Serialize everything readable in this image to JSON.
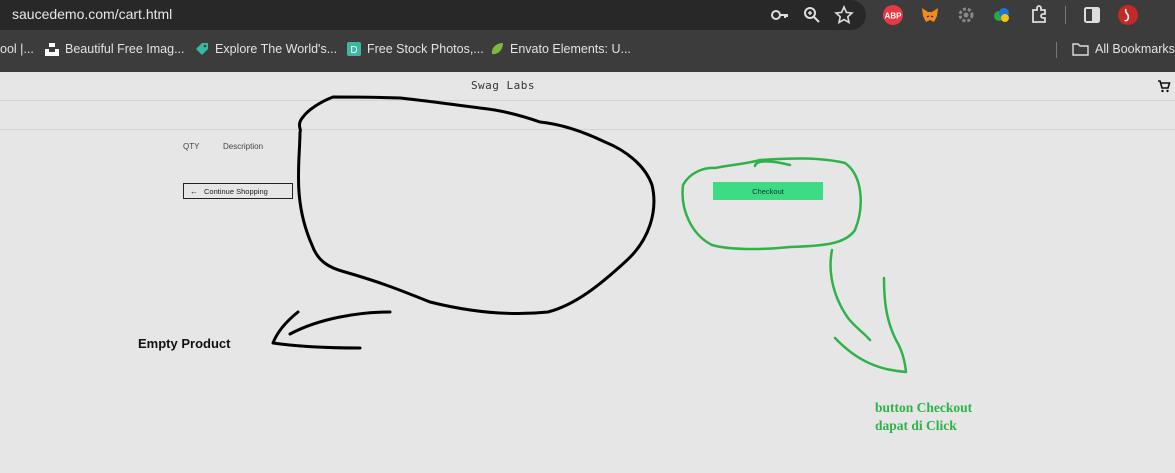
{
  "browser": {
    "url": "saucedemo.com/cart.html",
    "bookmarks": [
      {
        "label": "ool |..."
      },
      {
        "label": "Beautiful Free Imag..."
      },
      {
        "label": "Explore The World's..."
      },
      {
        "label": "Free Stock Photos,..."
      },
      {
        "label": "Envato Elements: U..."
      }
    ],
    "all_bookmarks_label": "All Bookmarks",
    "extensions": {
      "abp_label": "ABP"
    },
    "colors": {
      "chrome_bg": "#3c3c3c",
      "address_bg": "#282828"
    }
  },
  "header": {
    "logo": "Swag Labs"
  },
  "cart": {
    "qty_label": "QTY",
    "description_label": "Description",
    "continue_label": "Continue Shopping",
    "checkout_label": "Checkout"
  },
  "annotations": {
    "empty_product": "Empty Product",
    "checkout_note_line1": "button Checkout",
    "checkout_note_line2": "dapat di Click",
    "colors": {
      "black_marker": "#000000",
      "green_marker": "#2db34a",
      "checkout_button": "#3ddc84"
    }
  }
}
